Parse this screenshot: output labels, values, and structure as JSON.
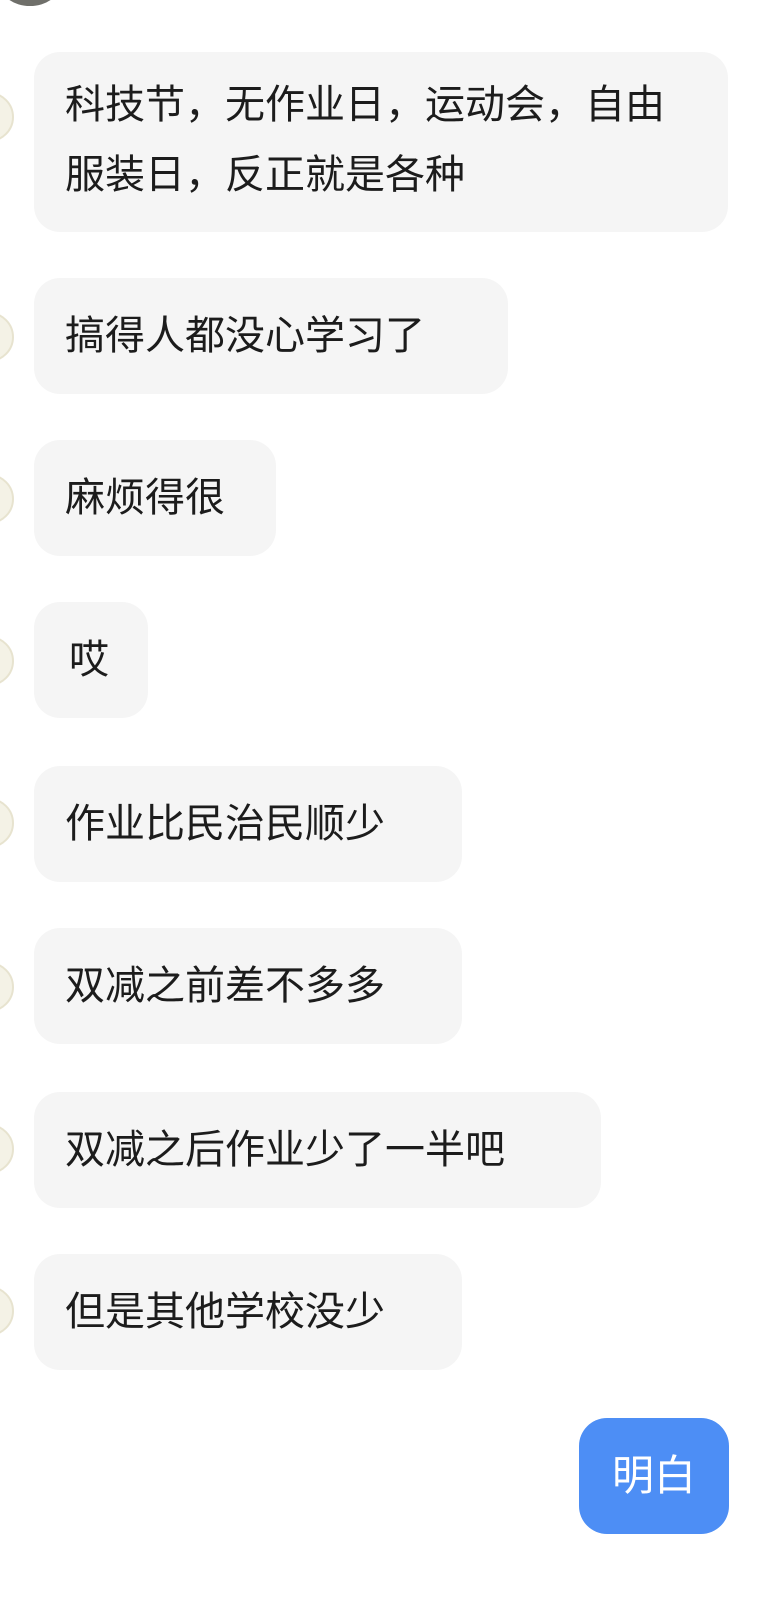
{
  "messages": [
    {
      "sender": "other",
      "text": "科技节，无作业日，运动会，自由服装日，反正就是各种"
    },
    {
      "sender": "other",
      "text": "搞得人都没心学习了"
    },
    {
      "sender": "other",
      "text": "麻烦得很"
    },
    {
      "sender": "other",
      "text": "哎"
    },
    {
      "sender": "other",
      "text": "作业比民治民顺少"
    },
    {
      "sender": "other",
      "text": "双减之前差不多多"
    },
    {
      "sender": "other",
      "text": "双减之后作业少了一半吧"
    },
    {
      "sender": "other",
      "text": "但是其他学校没少"
    },
    {
      "sender": "self",
      "text": "明白"
    }
  ],
  "colors": {
    "other_bubble": "#f5f5f5",
    "self_bubble": "#4d8ef5",
    "text": "#1c1c1c"
  }
}
